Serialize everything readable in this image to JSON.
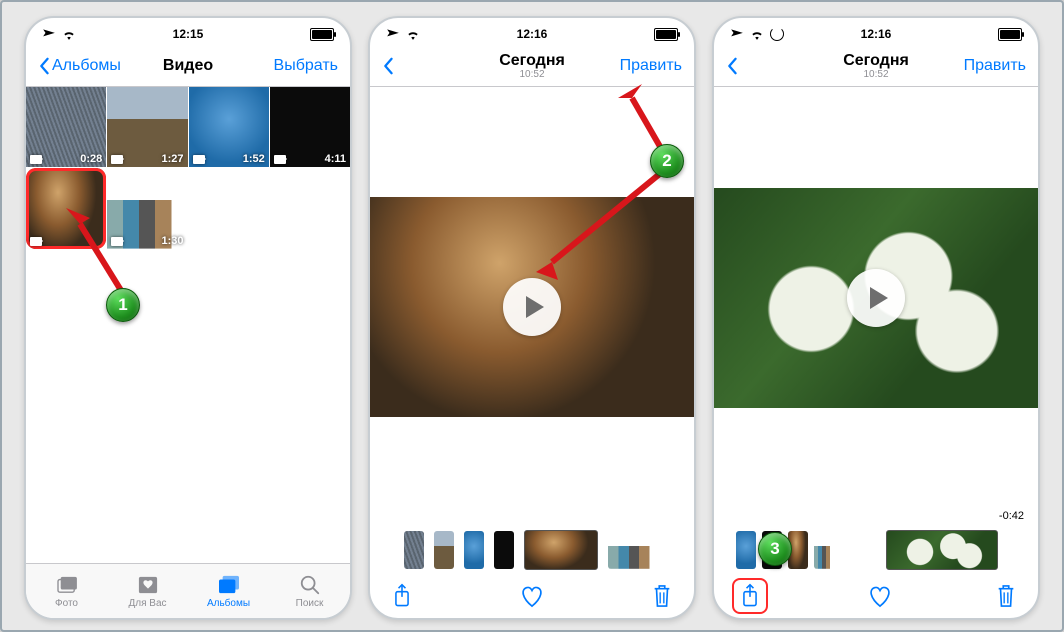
{
  "statusbar": {
    "time1": "12:15",
    "time2": "12:16",
    "time3": "12:16"
  },
  "screen1": {
    "back_label": "Альбомы",
    "title": "Видео",
    "select_label": "Выбрать",
    "thumbs": [
      {
        "duration": "0:28"
      },
      {
        "duration": "1:27"
      },
      {
        "duration": "1:52"
      },
      {
        "duration": "4:11"
      },
      {
        "duration": ""
      },
      {
        "duration": "1:30"
      }
    ],
    "tabs": {
      "photo": "Фото",
      "foryou": "Для Вас",
      "albums": "Альбомы",
      "search": "Поиск"
    }
  },
  "screen2": {
    "title": "Сегодня",
    "subtitle": "10:52",
    "edit_label": "Править"
  },
  "screen3": {
    "title": "Сегодня",
    "subtitle": "10:52",
    "edit_label": "Править",
    "timecode": "-0:42"
  },
  "markers": {
    "m1": "1",
    "m2": "2",
    "m3": "3"
  }
}
